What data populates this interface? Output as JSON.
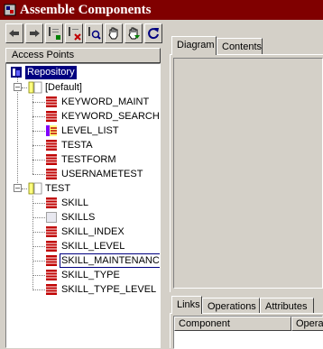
{
  "window": {
    "title": "Assemble Components"
  },
  "toolbar": {
    "buttons": [
      {
        "name": "move-left-button",
        "icon": "arrow-left-icon"
      },
      {
        "name": "move-right-button",
        "icon": "arrow-right-icon"
      },
      {
        "name": "add-component-button",
        "icon": "add-icon"
      },
      {
        "name": "remove-component-button",
        "icon": "remove-icon"
      },
      {
        "name": "find-button",
        "icon": "search-icon"
      },
      {
        "name": "grab-button",
        "icon": "hand-icon"
      },
      {
        "name": "drag-button",
        "icon": "hand-arrow-icon"
      },
      {
        "name": "refresh-button",
        "icon": "refresh-icon"
      }
    ]
  },
  "access_points": {
    "header": "Access Points",
    "root": "Repository",
    "groups": [
      {
        "label": "[Default]",
        "items": [
          "KEYWORD_MAINT",
          "KEYWORD_SEARCH",
          "LEVEL_LIST",
          "TESTA",
          "TESTFORM",
          "USERNAMETEST"
        ],
        "item_icons": [
          "table",
          "table",
          "list",
          "table",
          "table",
          "table"
        ]
      },
      {
        "label": "TEST",
        "items": [
          "SKILL",
          "SKILLS",
          "SKILL_INDEX",
          "SKILL_LEVEL",
          "SKILL_MAINTENANC",
          "SKILL_TYPE",
          "SKILL_TYPE_LEVEL"
        ],
        "item_icons": [
          "table",
          "blank",
          "table",
          "table",
          "table",
          "table",
          "table"
        ]
      }
    ],
    "selected_item": "SKILL_MAINTENANC"
  },
  "top_tabs": [
    "Diagram",
    "Contents"
  ],
  "bottom_tabs": [
    "Links",
    "Operations",
    "Attributes"
  ],
  "links_columns": [
    "Component",
    "Operat"
  ],
  "colors": {
    "title_bg": "#800000",
    "face": "#d4d0c8",
    "selection": "#000080",
    "table_icon": "#c00000",
    "folder": "#ffff80"
  }
}
